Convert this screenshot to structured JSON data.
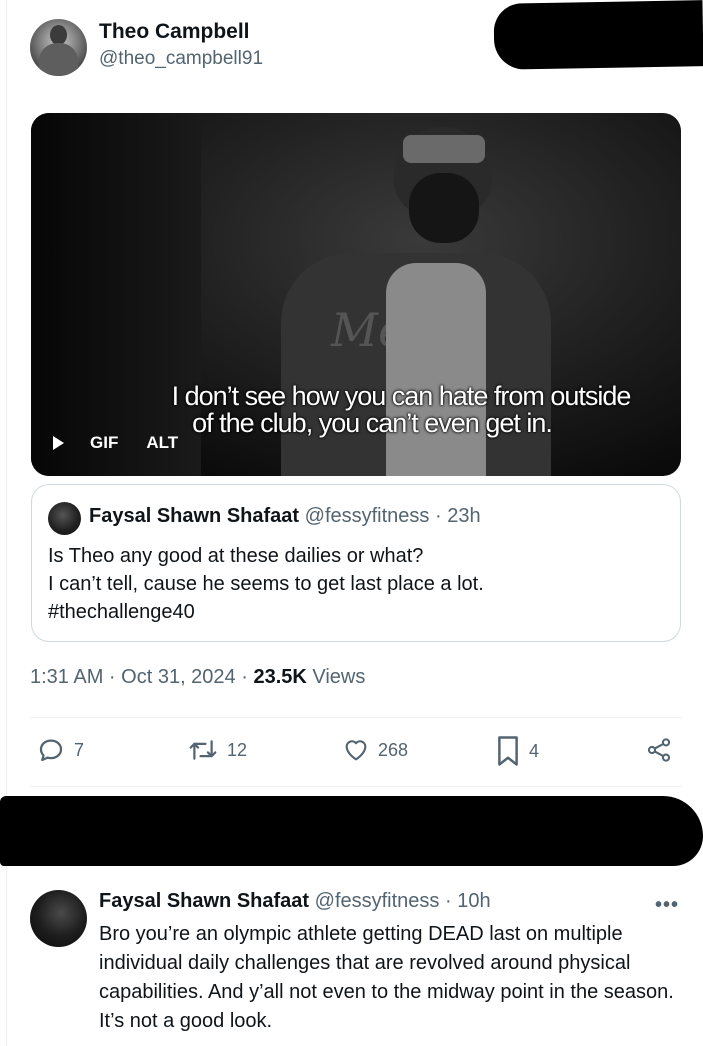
{
  "post": {
    "author_name": "Theo Campbell",
    "author_handle": "@theo_campbell91",
    "media": {
      "caption_line1": "I don’t see how you can hate from outside",
      "caption_line2": "of the club, you can’t even get in.",
      "gif_label": "GIF",
      "alt_label": "ALT",
      "jacket_text": "Mets"
    },
    "quote": {
      "author_name": "Faysal Shawn Shafaat",
      "author_meta": "@fessyfitness · 23h",
      "lines": [
        "Is Theo any good at these dailies or what?",
        "I can’t tell, cause he seems to get last place a lot.",
        "#thechallenge40"
      ]
    },
    "timestamp": "1:31 AM · Oct 31, 2024 · ",
    "views_count": "23.5K",
    "views_label": " Views",
    "actions": {
      "replies": "7",
      "reposts": "12",
      "likes": "268",
      "bookmarks": "4"
    }
  },
  "reply": {
    "author_name": "Faysal Shawn Shafaat",
    "author_meta": "@fessyfitness · 10h",
    "more": "•••",
    "text": "Bro you’re an olympic athlete getting DEAD last on multiple individual daily challenges that are revolved around physical capabilities. And y’all not even to the midway point in the season. It’s not a good look."
  }
}
